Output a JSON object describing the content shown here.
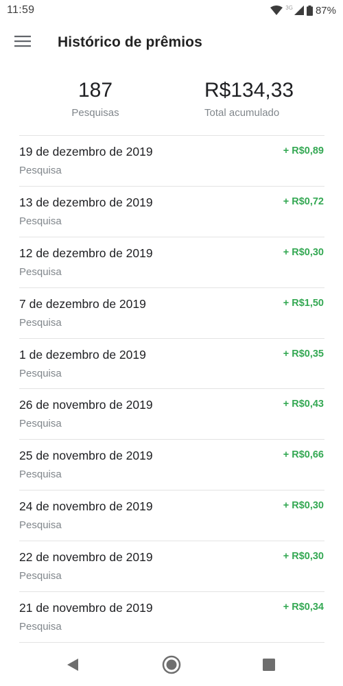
{
  "status": {
    "time": "11:59",
    "network": "3G",
    "battery": "87%"
  },
  "app_bar": {
    "title": "Histórico de prêmios"
  },
  "summary": {
    "surveys_count": "187",
    "surveys_label": "Pesquisas",
    "total_value": "R$134,33",
    "total_label": "Total acumulado"
  },
  "history": [
    {
      "date": "19 de dezembro de 2019",
      "type": "Pesquisa",
      "amount": "+ R$0,89"
    },
    {
      "date": "13 de dezembro de 2019",
      "type": "Pesquisa",
      "amount": "+ R$0,72"
    },
    {
      "date": "12 de dezembro de 2019",
      "type": "Pesquisa",
      "amount": "+ R$0,30"
    },
    {
      "date": "7 de dezembro de 2019",
      "type": "Pesquisa",
      "amount": "+ R$1,50"
    },
    {
      "date": "1 de dezembro de 2019",
      "type": "Pesquisa",
      "amount": "+ R$0,35"
    },
    {
      "date": "26 de novembro de 2019",
      "type": "Pesquisa",
      "amount": "+ R$0,43"
    },
    {
      "date": "25 de novembro de 2019",
      "type": "Pesquisa",
      "amount": "+ R$0,66"
    },
    {
      "date": "24 de novembro de 2019",
      "type": "Pesquisa",
      "amount": "+ R$0,30"
    },
    {
      "date": "22 de novembro de 2019",
      "type": "Pesquisa",
      "amount": "+ R$0,30"
    },
    {
      "date": "21 de novembro de 2019",
      "type": "Pesquisa",
      "amount": "+ R$0,34"
    }
  ],
  "colors": {
    "amount_positive": "#34a853",
    "secondary_text": "#80868b",
    "divider": "#e3e3e3"
  },
  "icons": {
    "menu": "hamburger-menu-icon",
    "wifi": "wifi-icon",
    "signal": "cell-signal-icon",
    "battery": "battery-icon",
    "back": "nav-back-icon",
    "home": "nav-home-icon",
    "recents": "nav-recents-icon"
  }
}
